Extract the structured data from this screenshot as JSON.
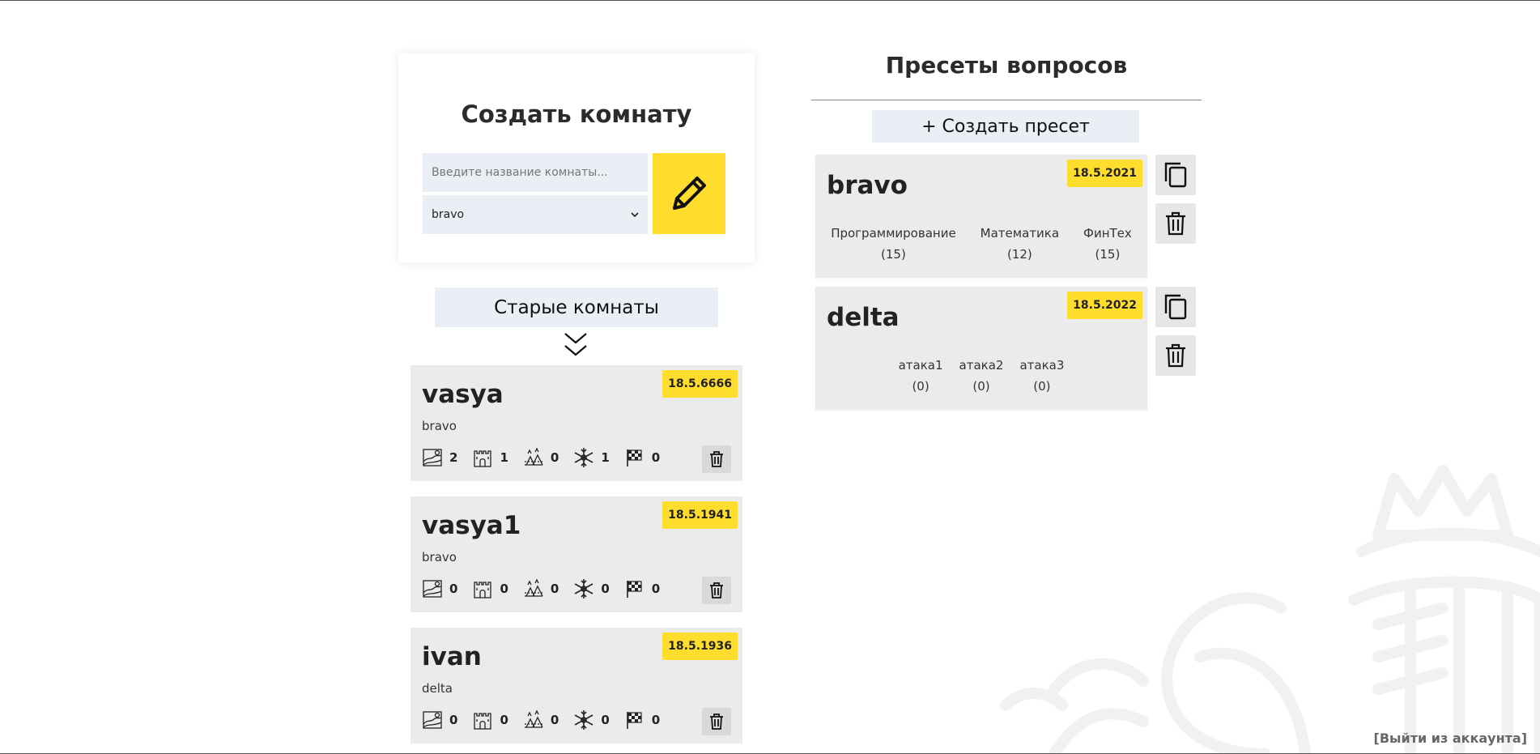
{
  "create_room": {
    "title": "Создать комнату",
    "input_placeholder": "Введите название комнаты...",
    "input_value": "",
    "selected_preset": "bravo",
    "create_icon": "pencil-icon"
  },
  "old_rooms": {
    "button_label": "Старые комнаты",
    "expand_icon": "double-chevron-down-icon",
    "rooms": [
      {
        "name": "vasya",
        "preset": "bravo",
        "date": "18.5.6666",
        "stats": [
          "2",
          "1",
          "0",
          "1",
          "0"
        ]
      },
      {
        "name": "vasya1",
        "preset": "bravo",
        "date": "18.5.1941",
        "stats": [
          "0",
          "0",
          "0",
          "0",
          "0"
        ]
      },
      {
        "name": "ivan",
        "preset": "delta",
        "date": "18.5.1936",
        "stats": [
          "0",
          "0",
          "0",
          "0",
          "0"
        ]
      }
    ],
    "stat_icons": [
      "landscape-icon",
      "castle-icon",
      "camp-icon",
      "snowflake-icon",
      "finish-flag-icon"
    ]
  },
  "presets": {
    "title": "Пресеты вопросов",
    "new_label": "+ Создать пресет",
    "items": [
      {
        "name": "bravo",
        "date": "18.5.2021",
        "categories": [
          {
            "name": "Программирование",
            "count": "(15)"
          },
          {
            "name": "Математика",
            "count": "(12)"
          },
          {
            "name": "ФинТех",
            "count": "(15)"
          }
        ]
      },
      {
        "name": "delta",
        "date": "18.5.2022",
        "categories": [
          {
            "name": "атака1",
            "count": "(0)"
          },
          {
            "name": "атака2",
            "count": "(0)"
          },
          {
            "name": "атака3",
            "count": "(0)"
          }
        ]
      }
    ]
  },
  "logout_label": "[Выйти из аккаунта]",
  "colors": {
    "accent": "#ffdd2d",
    "card": "#ebebed",
    "button": "#eaeef5"
  }
}
